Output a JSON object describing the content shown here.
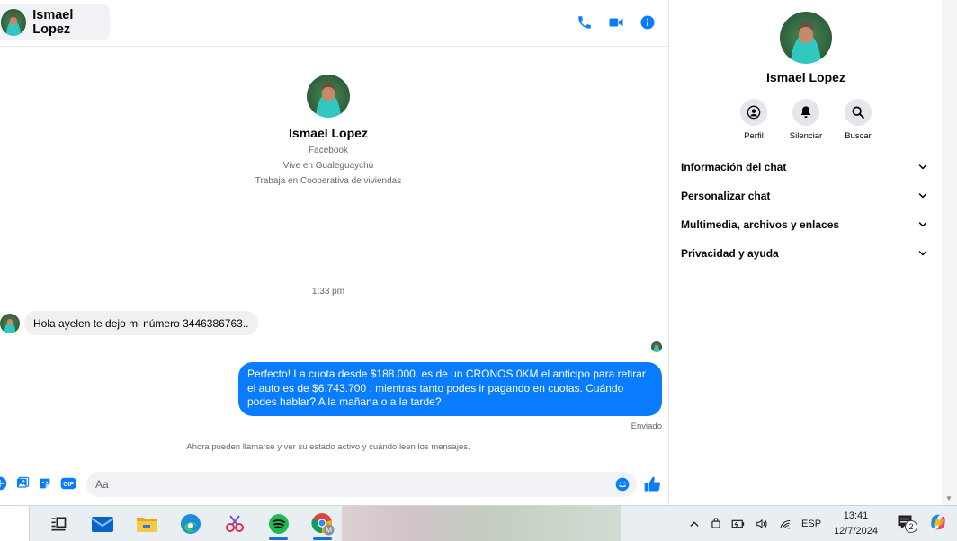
{
  "header": {
    "contact_name": "Ismael Lopez",
    "icons": [
      "phone-icon",
      "video-icon",
      "info-icon"
    ]
  },
  "intro": {
    "name": "Ismael Lopez",
    "line1": "Facebook",
    "line2": "Vive en Gualeguaychú",
    "line3": "Trabaja en Cooperativa de viviendas"
  },
  "conversation": {
    "timestamp": "1:33 pm",
    "incoming": "Hola ayelen te dejo mi número 3446386763..",
    "outgoing": "Perfecto! La cuota desde $188.000. es de un CRONOS 0KM el anticipo para retirar el auto es de $6.743.700 , mientras tanto podes ir pagando en cuotas. Cuándo podes hablar? A la mañana o a la tarde?",
    "status": "Enviado",
    "info": "Ahora pueden llamarse y ver su estado activo y cuándo leen los mensajes."
  },
  "composer": {
    "placeholder": "Aa",
    "gif_label": "GIF"
  },
  "panel": {
    "name": "Ismael Lopez",
    "actions": [
      {
        "label": "Perfil",
        "icon": "profile-icon"
      },
      {
        "label": "Silenciar",
        "icon": "bell-icon"
      },
      {
        "label": "Buscar",
        "icon": "search-icon"
      }
    ],
    "sections": [
      "Información del chat",
      "Personalizar chat",
      "Multimedia, archivos y enlaces",
      "Privacidad y ayuda"
    ]
  },
  "taskbar": {
    "apps": [
      "widgets-icon",
      "mail-icon",
      "file-explorer-icon",
      "edge-icon",
      "snipping-tool-icon",
      "spotify-icon",
      "chrome-icon"
    ],
    "language": "ESP",
    "time": "13:41",
    "date": "12/7/2024",
    "notifications": "2",
    "chrome_badge": "M"
  },
  "colors": {
    "accent": "#0a7cff",
    "bubble_in": "#f0f0f0",
    "secondary_text": "#65676b"
  }
}
